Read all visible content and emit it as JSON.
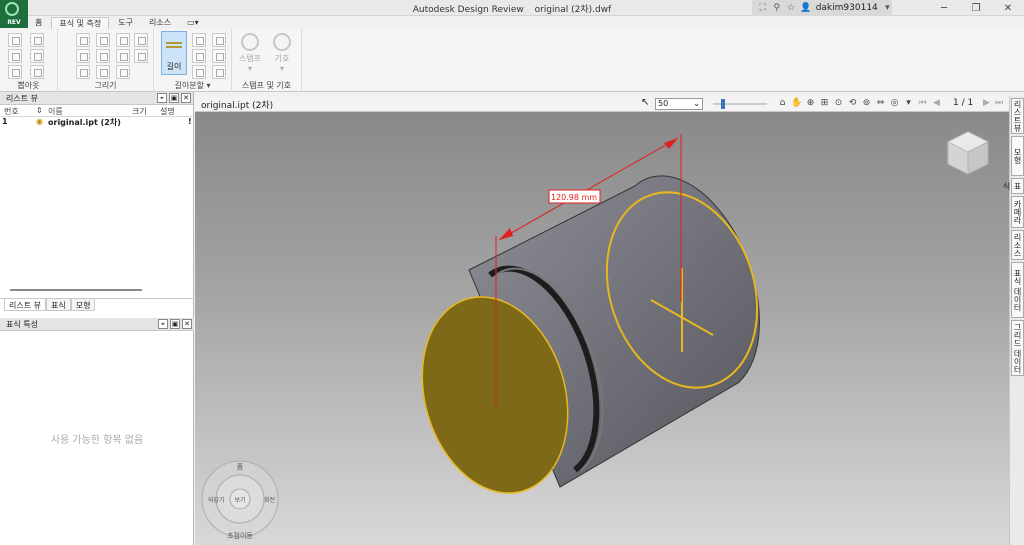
{
  "window": {
    "app_name": "Autodesk Design Review",
    "doc_title": "original (2차).dwf",
    "username": "dakim930114",
    "minimize": "─",
    "restore": "❐",
    "close": "✕"
  },
  "app_button": {
    "label": "REV"
  },
  "tabs": [
    "홈",
    "표식 및 측정",
    "도구",
    "리소스"
  ],
  "active_tab": 1,
  "ribbon": {
    "groups": {
      "g1": "뽑아옷",
      "g2": "그리기",
      "g3": "길이분할 ▾",
      "g4": "스탬프 및 기호"
    },
    "length_button": "길이",
    "stamp_button": "스탬프",
    "symbol_button": "기호",
    "dropdown_marker": "▾"
  },
  "list_view": {
    "title": "리스트 뷰",
    "columns": [
      "번호",
      "이름",
      "크기",
      "설명"
    ],
    "rows": [
      {
        "num": "1",
        "name": "original.ipt (2차)",
        "size": "",
        "desc": "!"
      }
    ]
  },
  "bottom_tabs": [
    "리스트 뷰",
    "표식",
    "모형"
  ],
  "markup_props": {
    "title": "표식 특성",
    "empty_message": "사용 가능한 항목 없음"
  },
  "viewer": {
    "file_tab": "original.ipt (2차)",
    "zoom": "50",
    "page": "1 / 1",
    "measurement": "120.98 mm"
  },
  "side_tabs": [
    "리스트뷰",
    "모형",
    "표식",
    "카메라",
    "리소스",
    "표식 데이터",
    "그리드 데이터"
  ],
  "nav_wheel": {
    "top": "줌",
    "left": "되감기",
    "right": "회전",
    "bottom": "초점이동",
    "center": "보기"
  },
  "colors": {
    "accent": "#3a75c4",
    "face": "#7d6918",
    "outline": "#e7b81e",
    "dimension": "#e0201e"
  }
}
